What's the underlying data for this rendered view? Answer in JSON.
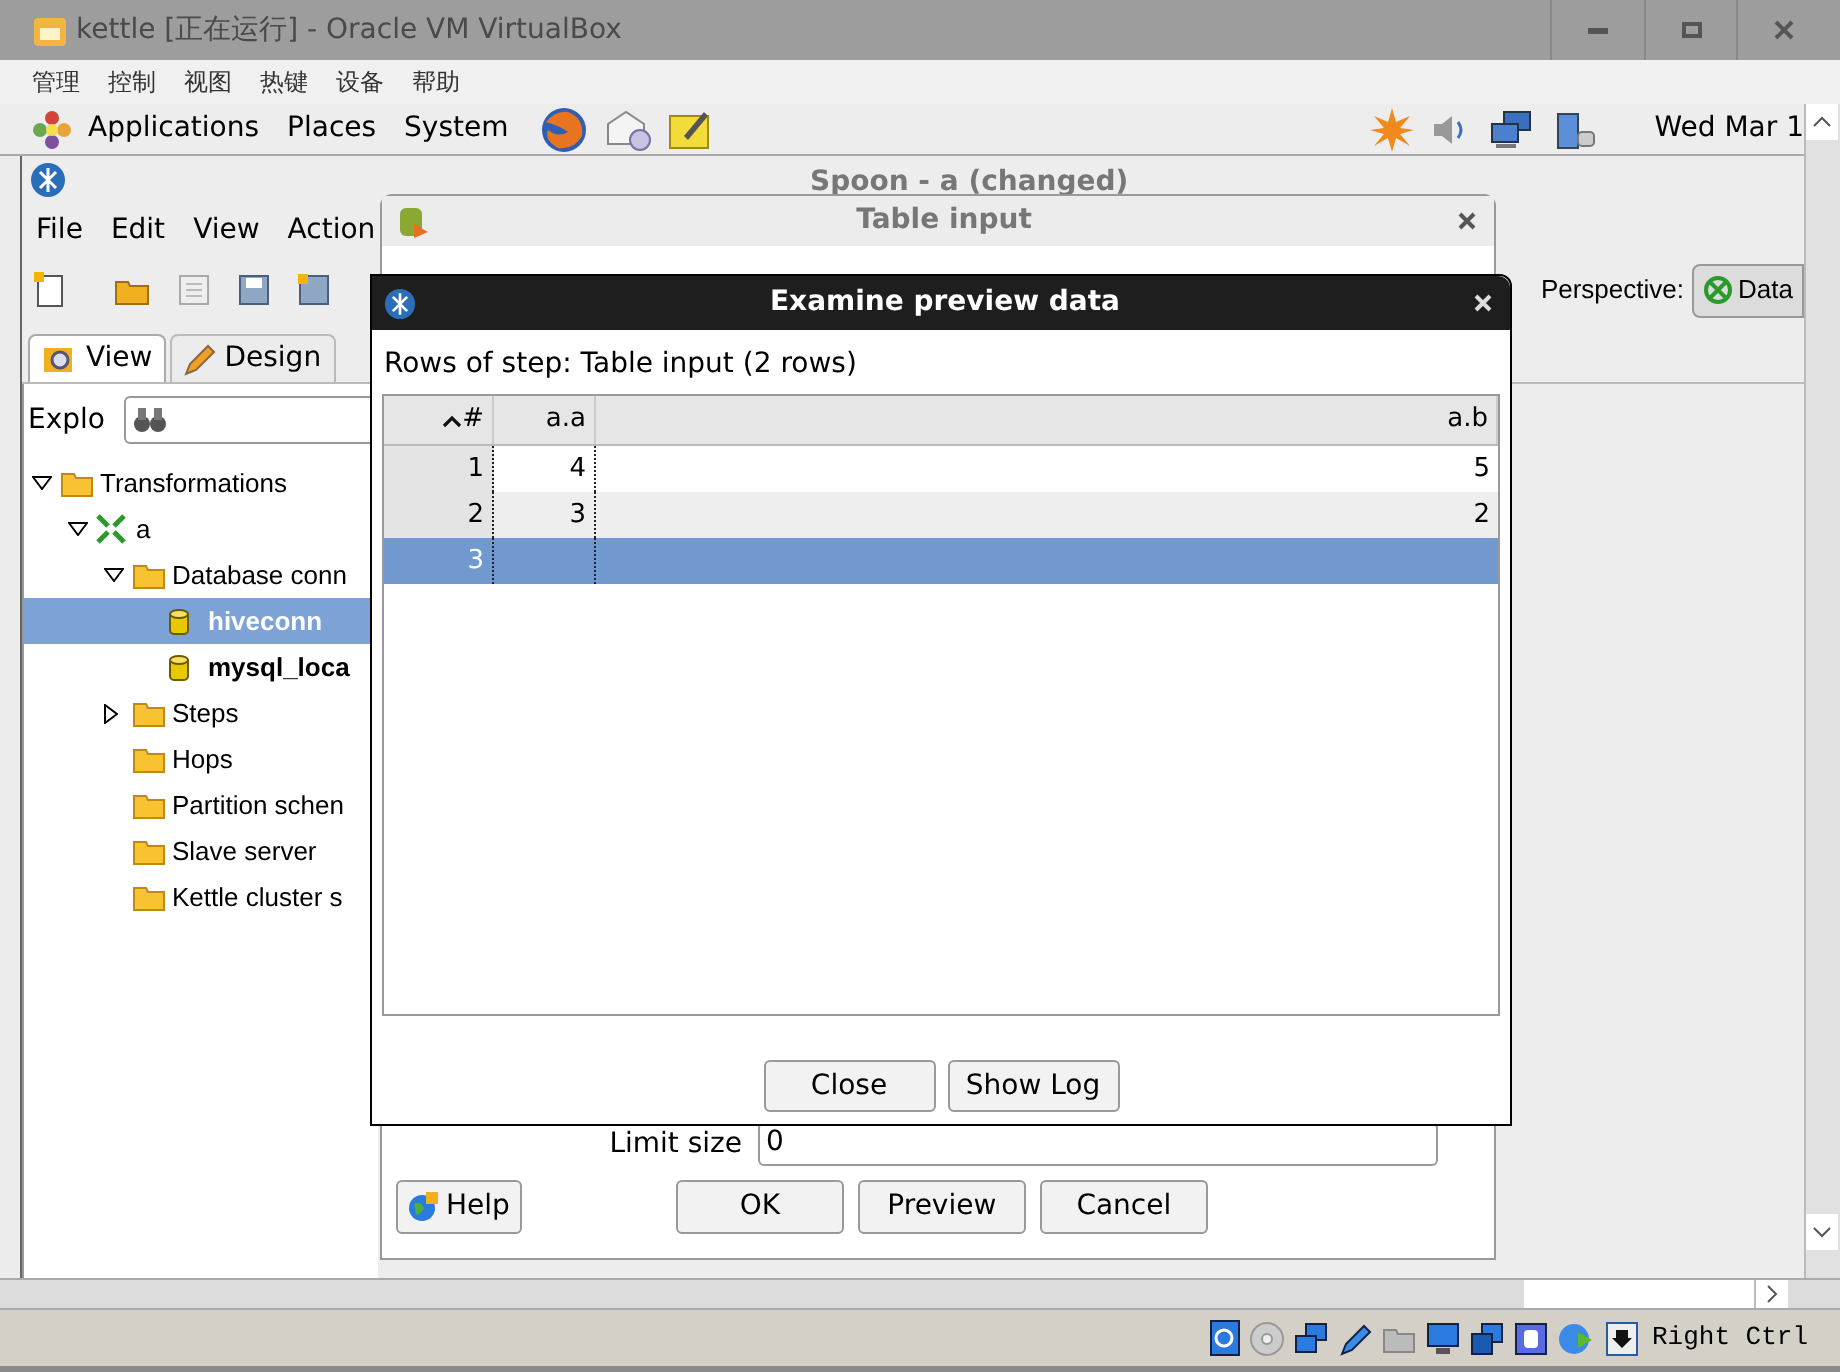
{
  "vbox": {
    "title": "kettle [正在运行] - Oracle VM VirtualBox",
    "menu": [
      "管理",
      "控制",
      "视图",
      "热键",
      "设备",
      "帮助"
    ],
    "host_key": "Right Ctrl"
  },
  "panel": {
    "menus": [
      "Applications",
      "Places",
      "System"
    ],
    "clock": "Wed Mar 1"
  },
  "spoon": {
    "title": "Spoon - a (changed)",
    "menu": [
      "File",
      "Edit",
      "View",
      "Action"
    ],
    "perspective_label": "Perspective:",
    "perspective_button": "Data",
    "tabs": [
      {
        "label": "View",
        "selected": true
      },
      {
        "label": "Design",
        "selected": false
      }
    ],
    "explorer_label": "Explo",
    "tree": [
      {
        "label": "Transformations",
        "kind": "folder",
        "expanded": true,
        "selected": false,
        "children": [
          {
            "label": "a",
            "kind": "transformation",
            "expanded": true,
            "selected": false,
            "children": [
              {
                "label": "Database conn",
                "kind": "folder",
                "expanded": true,
                "selected": false,
                "children": [
                  {
                    "label": "hiveconn",
                    "kind": "connection",
                    "selected": true
                  },
                  {
                    "label": "mysql_loca",
                    "kind": "connection",
                    "selected": false
                  }
                ]
              },
              {
                "label": "Steps",
                "kind": "folder",
                "expanded": false,
                "selected": false
              },
              {
                "label": "Hops",
                "kind": "folder",
                "selected": false
              },
              {
                "label": "Partition schen",
                "kind": "folder",
                "selected": false
              },
              {
                "label": "Slave server",
                "kind": "folder",
                "selected": false
              },
              {
                "label": "Kettle cluster s",
                "kind": "folder",
                "selected": false
              }
            ]
          }
        ]
      }
    ]
  },
  "table_input": {
    "title": "Table input",
    "limit_label": "Limit size",
    "limit_value": "0",
    "help_button": "Help",
    "buttons": [
      "OK",
      "Preview",
      "Cancel"
    ]
  },
  "preview": {
    "title": "Examine preview data",
    "caption": "Rows of step: Table input (2 rows)",
    "columns": [
      "#",
      "a.a",
      "a.b"
    ],
    "rows": [
      {
        "cells": [
          "1",
          "4",
          "5"
        ],
        "selected": false
      },
      {
        "cells": [
          "2",
          "3",
          "2"
        ],
        "selected": false
      },
      {
        "cells": [
          "3"
        ],
        "selected": true
      }
    ],
    "buttons": [
      "Close",
      "Show Log"
    ]
  }
}
